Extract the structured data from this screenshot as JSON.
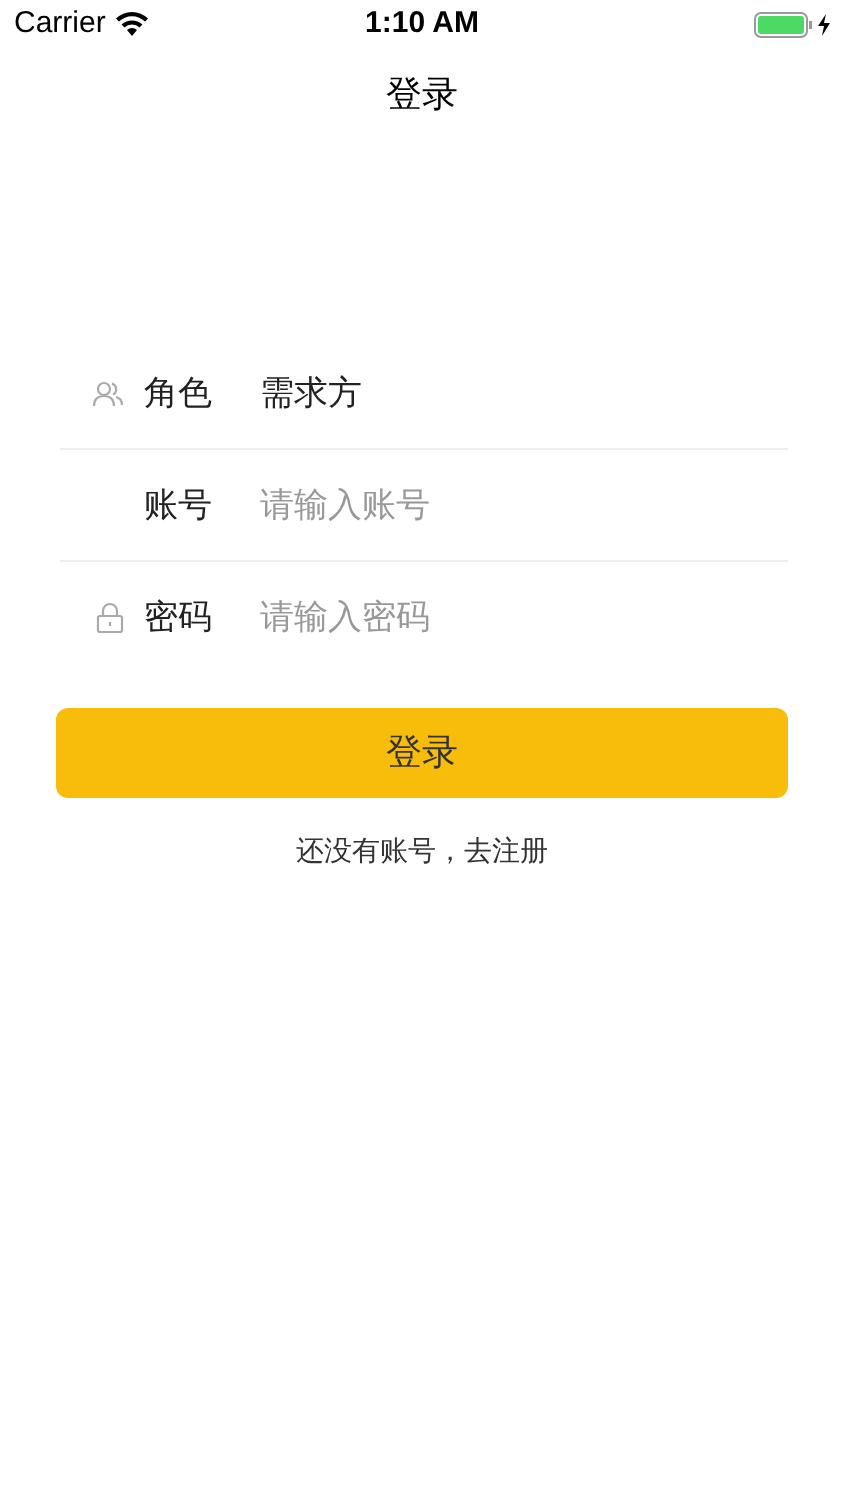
{
  "status_bar": {
    "carrier": "Carrier",
    "time": "1:10 AM"
  },
  "nav_bar": {
    "title": "登录"
  },
  "form": {
    "rows": [
      {
        "kind": "select",
        "label": "角色",
        "value": "需求方"
      },
      {
        "kind": "text",
        "label": "账号",
        "placeholder": "请输入账号"
      },
      {
        "kind": "password",
        "label": "密码",
        "placeholder": "请输入密码"
      }
    ]
  },
  "login_button": {
    "label": "登录"
  },
  "register_link": "还没有账号，去注册"
}
